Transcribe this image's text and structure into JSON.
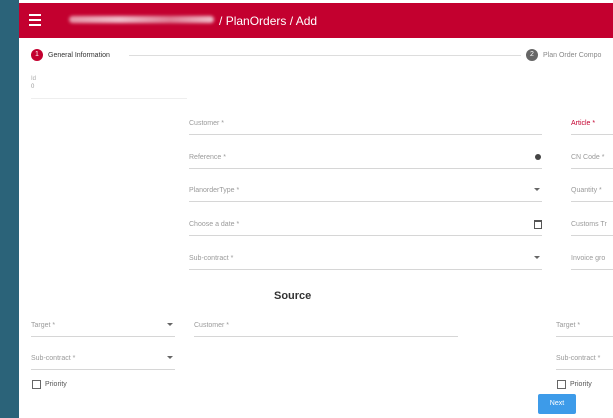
{
  "header": {
    "crumb_sep_1": "/",
    "crumb_planorders": "PlanOrders",
    "crumb_sep_2": "/",
    "crumb_add": "Add"
  },
  "stepper": {
    "step1": {
      "number": "1",
      "label": "General Information"
    },
    "step2": {
      "number": "2",
      "label": "Plan Order Compo"
    }
  },
  "general": {
    "id_label": "Id",
    "id_value": "0",
    "customer": "Customer *",
    "reference": "Reference *",
    "planorder_type": "PlanorderType *",
    "choose_date": "Choose a date *",
    "subcontract": "Sub-contract *",
    "article": "Article *",
    "cn_code": "CN Code *",
    "quantity": "Quantity *",
    "customs": "Customs Tr",
    "invoice": "Invoice gro"
  },
  "source": {
    "title": "Source",
    "target": "Target *",
    "customer": "Customer *",
    "subcontract": "Sub-contract *",
    "priority": "Priority"
  },
  "destination": {
    "target": "Target *",
    "subcontract": "Sub-contract *",
    "priority": "Priority"
  },
  "actions": {
    "next": "Next"
  },
  "colors": {
    "brand": "#c3002f",
    "button": "#3d9be9",
    "frame": "#2b6379"
  }
}
